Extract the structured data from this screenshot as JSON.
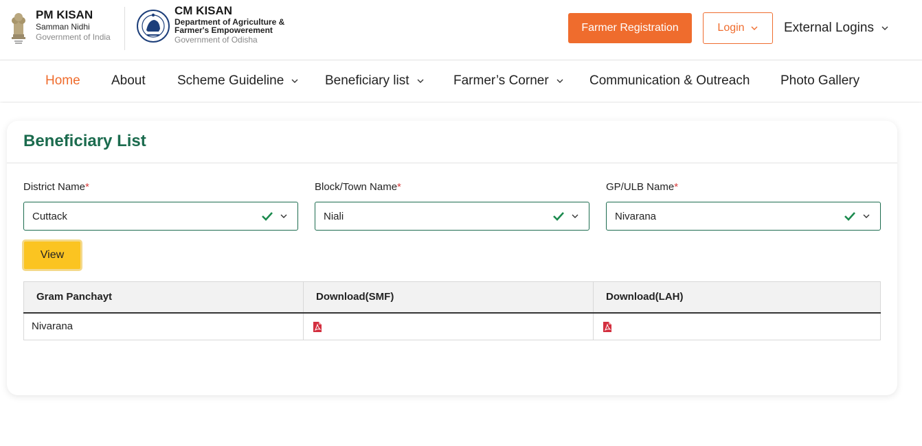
{
  "header": {
    "pm_kisan": {
      "title": "PM KISAN",
      "subtitle": "Samman Nidhi",
      "govt": "Government of India"
    },
    "cm_kisan": {
      "title": "CM KISAN",
      "dept_line1": "Department of Agriculture &",
      "dept_line2": "Farmer's Empowerement",
      "govt": "Government of Odisha"
    },
    "farmer_registration_label": "Farmer Registration",
    "login_label": "Login",
    "external_logins_label": "External Logins"
  },
  "nav": {
    "items": [
      {
        "label": "Home",
        "active": true,
        "dropdown": false
      },
      {
        "label": "About",
        "active": false,
        "dropdown": false
      },
      {
        "label": "Scheme Guideline",
        "active": false,
        "dropdown": true
      },
      {
        "label": "Beneficiary list",
        "active": false,
        "dropdown": true
      },
      {
        "label": "Farmer’s Corner",
        "active": false,
        "dropdown": true
      },
      {
        "label": "Communication & Outreach",
        "active": false,
        "dropdown": false
      },
      {
        "label": "Photo Gallery",
        "active": false,
        "dropdown": false
      }
    ]
  },
  "page": {
    "title": "Beneficiary List",
    "required_marker": "*",
    "fields": [
      {
        "label": "District Name",
        "value": "Cuttack"
      },
      {
        "label": "Block/Town Name",
        "value": "Niali"
      },
      {
        "label": "GP/ULB Name",
        "value": "Nivarana"
      }
    ],
    "view_button_label": "View",
    "table": {
      "headers": [
        "Gram Panchayt",
        "Download(SMF)",
        "Download(LAH)"
      ],
      "rows": [
        {
          "gram_panchayat": "Nivarana",
          "smf_icon": "pdf-icon",
          "lah_icon": "pdf-icon"
        }
      ]
    }
  },
  "colors": {
    "accent_orange": "#ef6c2d",
    "brand_green": "#1b6b4e",
    "view_yellow": "#fbc421",
    "pdf_red": "#d32f3f",
    "required_red": "#d83a3a"
  }
}
